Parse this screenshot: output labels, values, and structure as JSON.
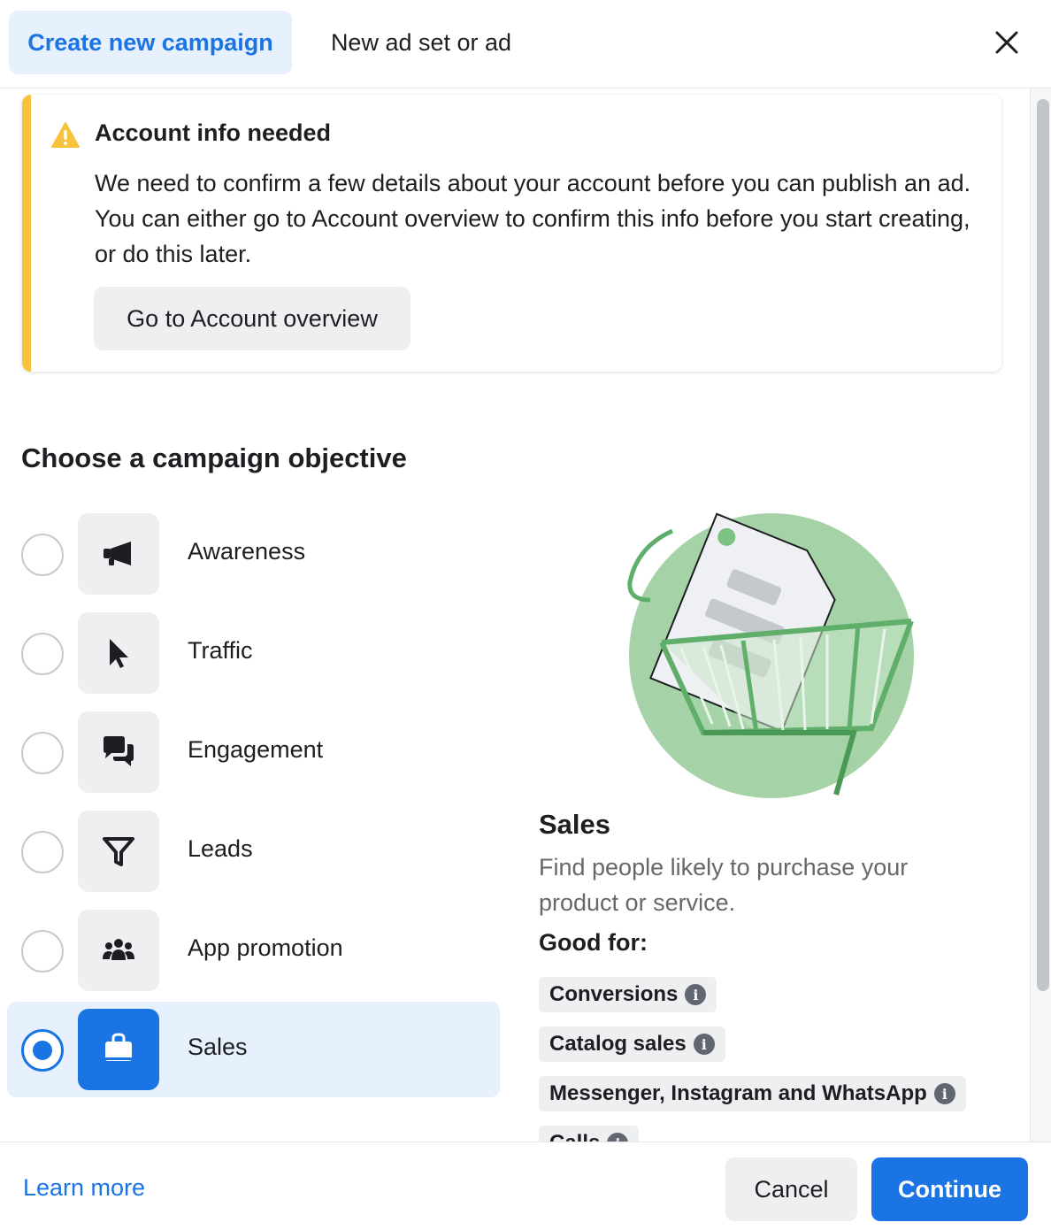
{
  "tabs": [
    {
      "label": "Create new campaign",
      "active": true
    },
    {
      "label": "New ad set or ad",
      "active": false
    }
  ],
  "close_icon": "close-icon",
  "warning": {
    "icon": "warning-triangle-icon",
    "title": "Account info needed",
    "text": "We need to confirm a few details about your account before you can publish an ad. You can either go to Account overview to confirm this info before you start creating, or do this later.",
    "button_label": "Go to Account overview"
  },
  "objective_section": {
    "title": "Choose a campaign objective",
    "options": [
      {
        "label": "Awareness",
        "icon": "megaphone-icon",
        "selected": false
      },
      {
        "label": "Traffic",
        "icon": "cursor-icon",
        "selected": false
      },
      {
        "label": "Engagement",
        "icon": "chat-bubbles-icon",
        "selected": false
      },
      {
        "label": "Leads",
        "icon": "funnel-icon",
        "selected": false
      },
      {
        "label": "App promotion",
        "icon": "people-group-icon",
        "selected": false
      },
      {
        "label": "Sales",
        "icon": "shopping-bag-icon",
        "selected": true
      }
    ]
  },
  "detail": {
    "illustration": "sales-tag-cart-illustration",
    "title": "Sales",
    "description": "Find people likely to purchase your product or service.",
    "good_for_label": "Good for:",
    "chips": [
      "Conversions",
      "Catalog sales",
      "Messenger, Instagram and WhatsApp",
      "Calls"
    ]
  },
  "footer": {
    "learn_more": "Learn more",
    "cancel": "Cancel",
    "continue": "Continue"
  },
  "colors": {
    "accent": "#1b74e4",
    "warning": "#f7c23c",
    "selected_bg": "#e7f0fd",
    "illustration_green": "#a5d3a7"
  }
}
